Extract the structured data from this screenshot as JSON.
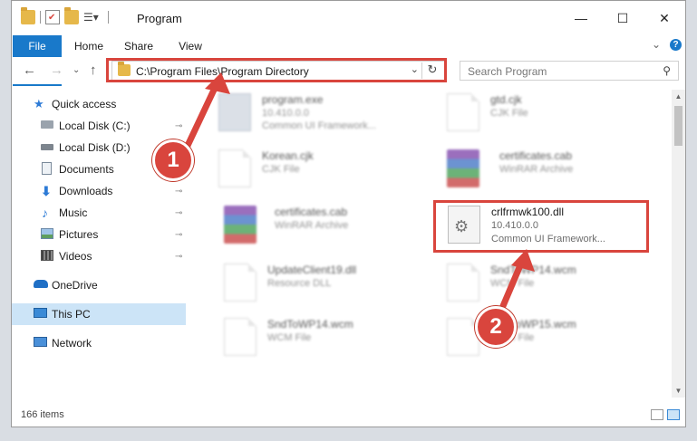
{
  "window": {
    "title": "Program",
    "controls": {
      "minimize": "—",
      "maximize": "☐",
      "close": "✕"
    }
  },
  "ribbon": {
    "tabs": [
      "File",
      "Home",
      "Share",
      "View"
    ],
    "expand": "⌄",
    "help": "?"
  },
  "nav": {
    "back": "←",
    "forward": "→",
    "recent": "⌄",
    "up": "↑",
    "address": "C:\\Program Files\\Program Directory",
    "address_dropdown": "⌄",
    "refresh": "↻",
    "search_placeholder": "Search Program",
    "search_icon": "⚲"
  },
  "sidebar": {
    "items": [
      {
        "label": "Quick access",
        "icon": "star-icon",
        "pinned": false
      },
      {
        "label": "Local Disk (C:)",
        "icon": "drive-icon",
        "pinned": true
      },
      {
        "label": "Local Disk (D:)",
        "icon": "drive-icon",
        "pinned": false
      },
      {
        "label": "Documents",
        "icon": "documents-icon",
        "pinned": true
      },
      {
        "label": "Downloads",
        "icon": "download-icon",
        "pinned": true
      },
      {
        "label": "Music",
        "icon": "music-icon",
        "pinned": true
      },
      {
        "label": "Pictures",
        "icon": "pictures-icon",
        "pinned": true
      },
      {
        "label": "Videos",
        "icon": "videos-icon",
        "pinned": true
      },
      {
        "label": "OneDrive",
        "icon": "cloud-icon",
        "pinned": false
      },
      {
        "label": "This PC",
        "icon": "computer-icon",
        "pinned": false,
        "selected": true
      },
      {
        "label": "Network",
        "icon": "network-icon",
        "pinned": false
      }
    ],
    "pin_glyph": "📌"
  },
  "files": [
    {
      "name": "program.exe",
      "line2": "10.410.0.0",
      "line3": "Common UI Framework...",
      "kind": "exe",
      "blurred": true
    },
    {
      "name": "gtd.cjk",
      "line2": "CJK File",
      "line3": "",
      "kind": "doc",
      "blurred": true
    },
    {
      "name": "Korean.cjk",
      "line2": "CJK File",
      "line3": "",
      "kind": "doc",
      "blurred": true
    },
    {
      "name": "certificates.cab",
      "line2": "WinRAR Archive",
      "line3": "",
      "kind": "rar",
      "blurred": true
    },
    {
      "name": "certificates.cab",
      "line2": "WinRAR Archive",
      "line3": "",
      "kind": "rar",
      "blurred": true
    },
    {
      "name": "crlfrmwk100.dll",
      "line2": "10.410.0.0",
      "line3": "Common UI Framework...",
      "kind": "dll",
      "blurred": false
    },
    {
      "name": "UpdateClient19.dll",
      "line2": "Resource DLL",
      "line3": "",
      "kind": "doc",
      "blurred": true
    },
    {
      "name": "SndToWP14.wcm",
      "line2": "WCM File",
      "line3": "",
      "kind": "doc",
      "blurred": true
    },
    {
      "name": "SndToWP14.wcm",
      "line2": "WCM File",
      "line3": "",
      "kind": "doc",
      "blurred": true
    },
    {
      "name": "SndToWP15.wcm",
      "line2": "WCM File",
      "line3": "",
      "kind": "doc",
      "blurred": true
    }
  ],
  "status": {
    "count": "166 items"
  },
  "annotations": {
    "step1": "1",
    "step2": "2",
    "color": "#d9453d"
  },
  "colors": {
    "accent": "#1979ca",
    "selected": "#cce4f7",
    "annotation": "#d9453d"
  }
}
